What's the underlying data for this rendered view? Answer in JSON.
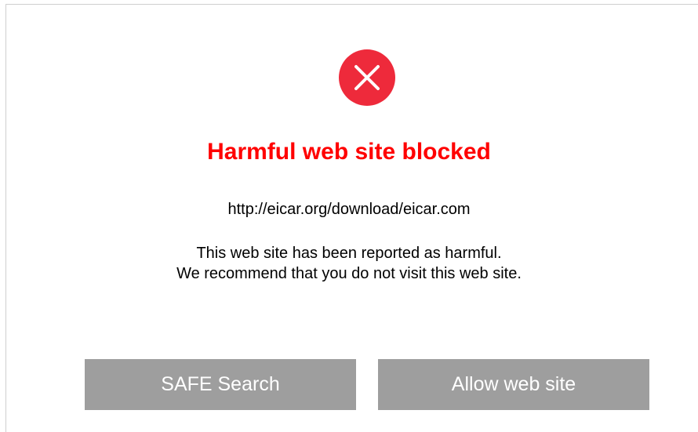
{
  "colors": {
    "accent": "#ff0000",
    "icon_circle": "#ee2a3b",
    "button_bg": "#9e9e9e",
    "button_text": "#ffffff"
  },
  "icon": "error-x-circle-icon",
  "title": "Harmful web site blocked",
  "url": "http://eicar.org/download/eicar.com",
  "message": {
    "line1": "This web site has been reported as harmful.",
    "line2": "We recommend that you do not visit this web site."
  },
  "buttons": {
    "safe_search": "SAFE Search",
    "allow": "Allow web site"
  }
}
